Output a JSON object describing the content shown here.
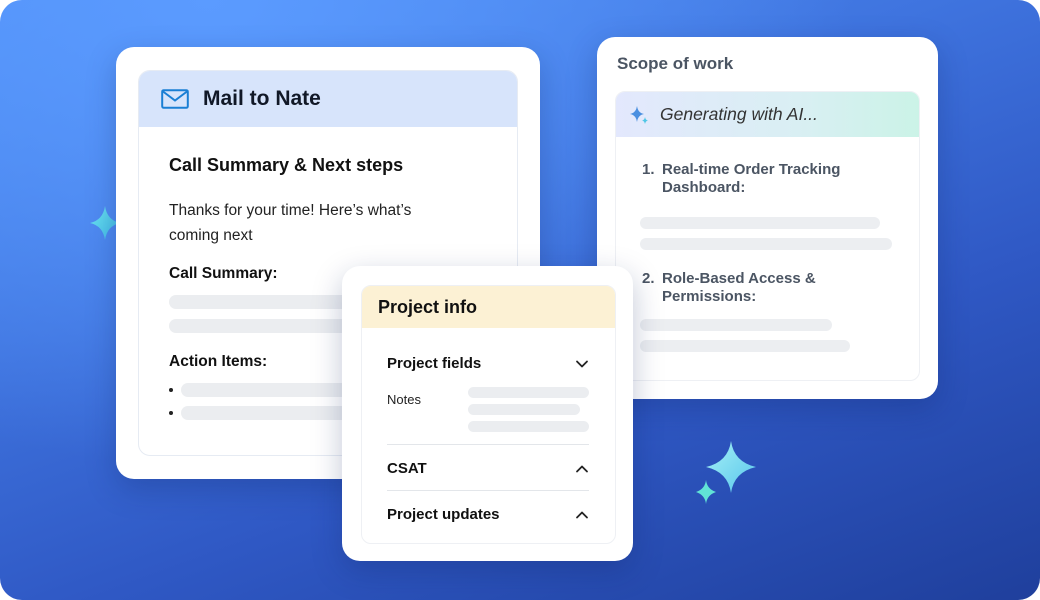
{
  "mail": {
    "title": "Mail to Nate",
    "subject": "Call Summary & Next steps",
    "body": "Thanks for your time! Here’s what’s coming next",
    "summary_heading": "Call Summary:",
    "actions_heading": "Action Items:"
  },
  "scope": {
    "title": "Scope of work",
    "generating": "Generating with AI...",
    "items": [
      {
        "num": "1.",
        "text": "Real-time Order Tracking Dashboard:"
      },
      {
        "num": "2.",
        "text": "Role-Based Access & Permissions:"
      }
    ]
  },
  "project": {
    "title": "Project info",
    "fields_label": "Project fields",
    "notes_label": "Notes",
    "csat_label": "CSAT",
    "updates_label": "Project updates"
  },
  "colors": {
    "mail_header": "#d7e4fb",
    "project_header": "#fcf1d4",
    "accent_blue": "#1a7fd4",
    "sparkle_cyan": "#5ee4e0"
  }
}
